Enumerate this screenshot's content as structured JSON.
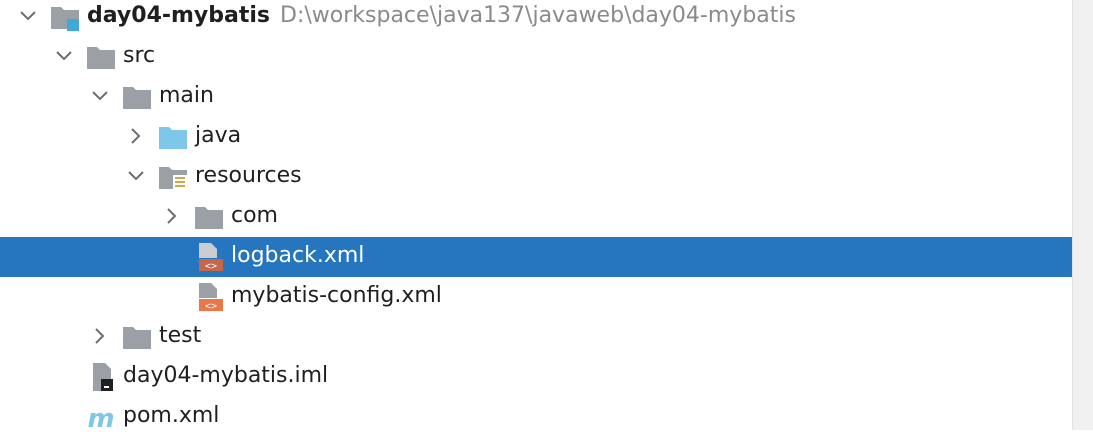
{
  "project": {
    "name": "day04-mybatis",
    "path": "D:\\workspace\\java137\\javaweb\\day04-mybatis"
  },
  "tree": {
    "src": "src",
    "main": "main",
    "java": "java",
    "resources": "resources",
    "com": "com",
    "logback": "logback.xml",
    "mybatis_config": "mybatis-config.xml",
    "test": "test",
    "iml": "day04-mybatis.iml",
    "pom": "pom.xml"
  },
  "icons": {
    "folder": "folder-icon",
    "source_root": "source-root-folder-icon",
    "resources_root": "resources-folder-icon",
    "xml": "xml-file-icon",
    "iml": "iml-file-icon",
    "maven": "maven-icon"
  },
  "colors": {
    "selection": "#2675bf",
    "folder_gray": "#9aa0a6",
    "source_blue": "#7dc8e8",
    "xml_orange": "#e8774a"
  }
}
